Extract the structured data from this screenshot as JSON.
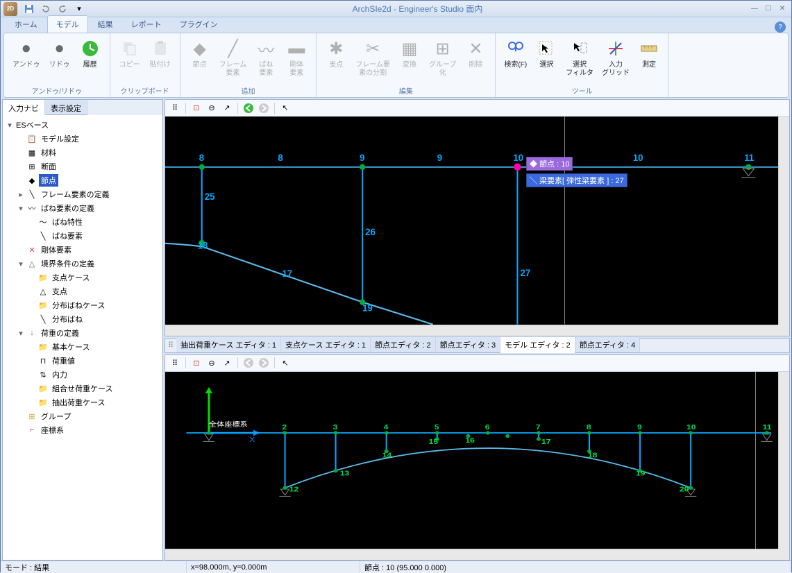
{
  "app": {
    "title": "ArchSIe2d - Engineer's Studio 面内",
    "icon_text": "2D"
  },
  "qat": [
    "save",
    "undo",
    "redo",
    "dropdown"
  ],
  "menu": {
    "tabs": [
      "ホーム",
      "モデル",
      "結果",
      "レポート",
      "プラグイン"
    ],
    "active_index": 1
  },
  "ribbon": {
    "groups": [
      {
        "label": "アンドゥ/リドゥ",
        "buttons": [
          {
            "id": "undo",
            "label": "アンドゥ",
            "enabled": false
          },
          {
            "id": "redo",
            "label": "リドゥ",
            "enabled": false
          },
          {
            "id": "history",
            "label": "履歴",
            "enabled": true
          }
        ]
      },
      {
        "label": "クリップボード",
        "buttons": [
          {
            "id": "copy",
            "label": "コピー",
            "enabled": false
          },
          {
            "id": "paste",
            "label": "貼付け",
            "enabled": false
          }
        ]
      },
      {
        "label": "追加",
        "buttons": [
          {
            "id": "node",
            "label": "節点",
            "enabled": false
          },
          {
            "id": "frame",
            "label": "フレーム\n要素",
            "enabled": false
          },
          {
            "id": "spring",
            "label": "ばね\n要素",
            "enabled": false
          },
          {
            "id": "rigid",
            "label": "剛体\n要素",
            "enabled": false
          }
        ]
      },
      {
        "label": "編集",
        "buttons": [
          {
            "id": "support",
            "label": "支点",
            "enabled": false
          },
          {
            "id": "divide",
            "label": "フレーム要\n素の分割",
            "enabled": false
          },
          {
            "id": "transform",
            "label": "変換",
            "enabled": false
          },
          {
            "id": "group",
            "label": "グループ\n化",
            "enabled": false
          },
          {
            "id": "delete",
            "label": "削除",
            "enabled": false
          }
        ]
      },
      {
        "label": "ツール",
        "buttons": [
          {
            "id": "search",
            "label": "検索(F)",
            "enabled": true
          },
          {
            "id": "select",
            "label": "選択",
            "enabled": true
          },
          {
            "id": "filter",
            "label": "選択\nフィルタ",
            "enabled": true
          },
          {
            "id": "grid",
            "label": "入力\nグリッド",
            "enabled": true
          },
          {
            "id": "measure",
            "label": "測定",
            "enabled": true
          }
        ]
      }
    ]
  },
  "left_panel": {
    "tabs": [
      "入力ナビ",
      "表示設定"
    ],
    "active_index": 0,
    "tree": {
      "root_label": "ESベース",
      "items": [
        {
          "label": "モデル設定",
          "icon": "model-setting"
        },
        {
          "label": "材料",
          "icon": "material"
        },
        {
          "label": "断面",
          "icon": "section"
        },
        {
          "label": "節点",
          "icon": "node",
          "selected": true
        },
        {
          "label": "フレーム要素の定義",
          "icon": "frame",
          "expandable": true
        },
        {
          "label": "ばね要素の定義",
          "icon": "spring",
          "expanded": true,
          "children": [
            {
              "label": "ばね特性",
              "icon": "spring-prop"
            },
            {
              "label": "ばね要素",
              "icon": "spring-elem"
            }
          ]
        },
        {
          "label": "剛体要素",
          "icon": "rigid"
        },
        {
          "label": "境界条件の定義",
          "icon": "boundary",
          "expanded": true,
          "children": [
            {
              "label": "支点ケース",
              "icon": "folder"
            },
            {
              "label": "支点",
              "icon": "support"
            },
            {
              "label": "分布ばねケース",
              "icon": "folder"
            },
            {
              "label": "分布ばね",
              "icon": "dist-spring"
            }
          ]
        },
        {
          "label": "荷重の定義",
          "icon": "load",
          "expanded": true,
          "children": [
            {
              "label": "基本ケース",
              "icon": "folder"
            },
            {
              "label": "荷重値",
              "icon": "load-value"
            },
            {
              "label": "内力",
              "icon": "internal"
            },
            {
              "label": "組合せ荷重ケース",
              "icon": "folder"
            },
            {
              "label": "抽出荷重ケース",
              "icon": "folder"
            }
          ]
        },
        {
          "label": "グループ",
          "icon": "group-folder"
        },
        {
          "label": "座標系",
          "icon": "coord"
        }
      ]
    }
  },
  "editor_tabs": {
    "tabs": [
      "抽出荷重ケース エディタ : 1",
      "支点ケース エディタ : 1",
      "節点エディタ : 2",
      "節点エディタ : 3",
      "モデル エディタ : 2",
      "節点エディタ : 4"
    ],
    "active_index": 4
  },
  "top_canvas": {
    "tooltip_node": "節点 : 10",
    "tooltip_beam": "梁要素[ 弾性梁要素 ] : 27",
    "node_labels": {
      "n8": "8",
      "n9": "9",
      "n10": "10",
      "n11": "11",
      "n18": "18",
      "n19": "19",
      "n25": "25",
      "n26": "26",
      "n27": "27",
      "e8": "8",
      "e9": "9",
      "e10": "10",
      "e17": "17"
    }
  },
  "bottom_canvas": {
    "coord_label": "全体座標系",
    "axis_x": "X",
    "node_labels": {
      "n2": "2",
      "n3": "3",
      "n4": "4",
      "n5": "5",
      "n6": "6",
      "n7": "7",
      "n8": "8",
      "n9": "9",
      "n10": "10",
      "n11": "11",
      "n12": "12",
      "n13": "13",
      "n14": "14",
      "n15": "15",
      "n16": "16",
      "n17": "17",
      "n18": "18",
      "n19": "19",
      "n20": "20"
    }
  },
  "statusbar": {
    "mode": "モード : 結果",
    "coords": "x=98.000m, y=0.000m",
    "selection": "節点 : 10 (95.000 0.000)"
  }
}
